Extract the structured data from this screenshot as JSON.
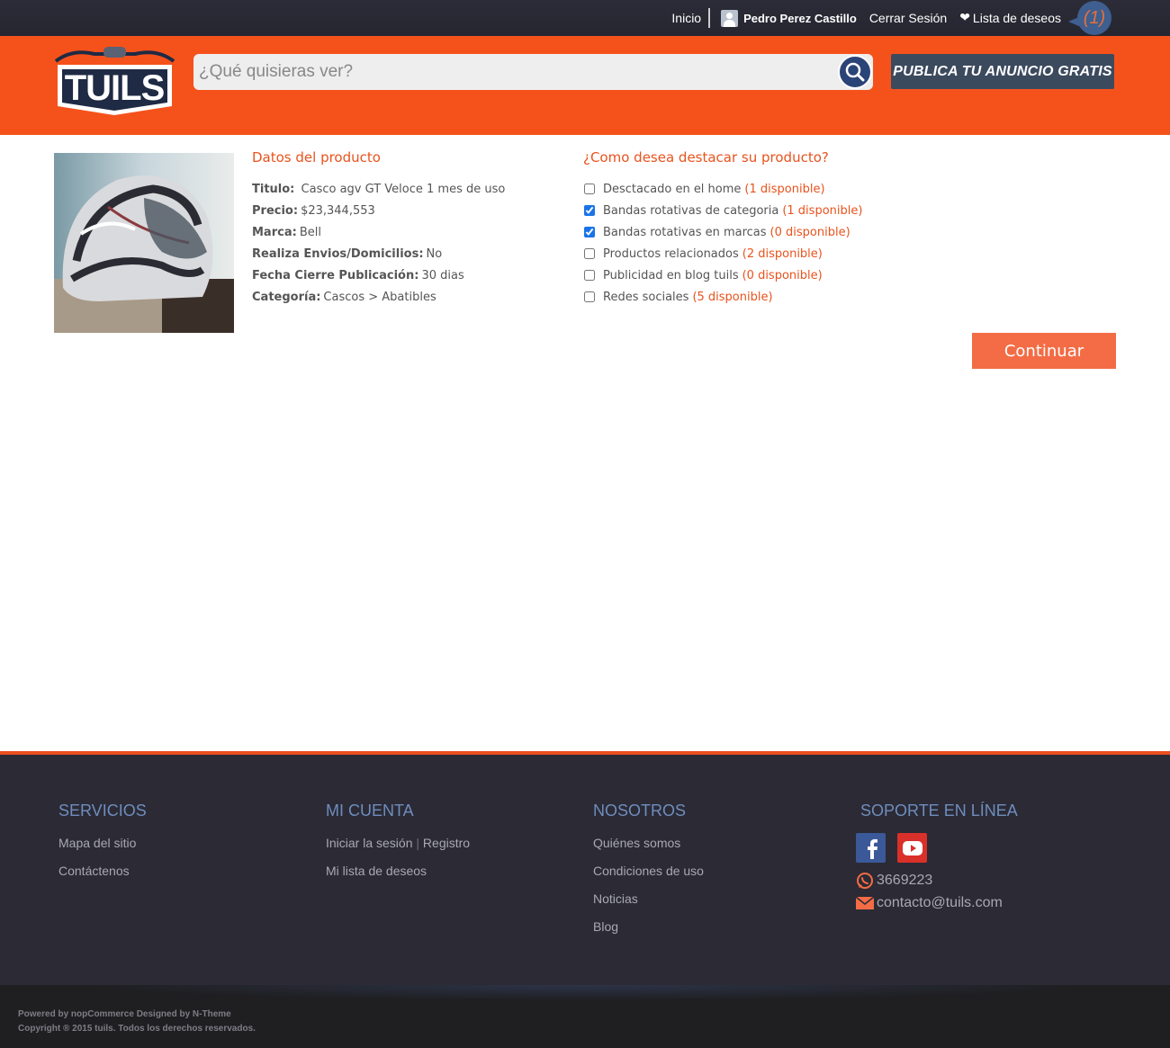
{
  "topbar": {
    "home": "Inicio",
    "user_name": "Pedro Perez Castillo",
    "logout": "Cerrar Sesión",
    "wishlist": "Lista de deseos",
    "wishlist_count": "(1)"
  },
  "header": {
    "logo_text": "TUILS",
    "search_placeholder": "¿Qué quisieras ver?",
    "publish_label": "PUBLICA TU ANUNCIO GRATIS"
  },
  "product": {
    "section_title": "Datos del producto",
    "details": [
      {
        "label": "Titulo:",
        "value": " Casco agv GT Veloce 1 mes de uso"
      },
      {
        "label": "Precio:",
        "value": "$23,344,553"
      },
      {
        "label": "Marca:",
        "value": "Bell"
      },
      {
        "label": "Realiza Envios/Domicilios:",
        "value": "No"
      },
      {
        "label": "Fecha Cierre Publicación:",
        "value": "30 dias"
      },
      {
        "label": "Categoría:",
        "value": "Cascos > Abatibles"
      }
    ]
  },
  "highlight": {
    "section_title": "¿Como desea destacar su producto?",
    "options": [
      {
        "label": "Desctacado en el home",
        "availability": "(1 disponible)",
        "checked": false
      },
      {
        "label": "Bandas rotativas de categoria",
        "availability": "(1 disponible)",
        "checked": true
      },
      {
        "label": "Bandas rotativas en marcas",
        "availability": "(0 disponible)",
        "checked": true
      },
      {
        "label": "Productos relacionados",
        "availability": "(2 disponible)",
        "checked": false
      },
      {
        "label": "Publicidad en blog tuils",
        "availability": "(0 disponible)",
        "checked": false
      },
      {
        "label": "Redes sociales",
        "availability": "(5 disponible)",
        "checked": false
      }
    ],
    "continue_label": "Continuar"
  },
  "footer": {
    "servicios": {
      "title": "SERVICIOS",
      "links": [
        "Mapa del sitio",
        "Contáctenos"
      ]
    },
    "cuenta": {
      "title": "MI CUENTA",
      "login": "Iniciar la sesión",
      "sep": "|",
      "register": "Registro",
      "wishlist": "Mi lista de deseos"
    },
    "nosotros": {
      "title": "NOSOTROS",
      "links": [
        "Quiénes somos",
        "Condiciones de uso",
        "Noticias",
        "Blog"
      ]
    },
    "soporte": {
      "title": "SOPORTE EN LÍNEA",
      "phone": "3669223",
      "email": "contacto@tuils.com"
    },
    "powered": "Powered by nopCommerce Designed by N-Theme",
    "copyright": "Copyright ® 2015 tuils. Todos los derechos reservados."
  },
  "colors": {
    "brand_orange": "#f5521b",
    "topbar_dark": "#2a2a35",
    "footer_heading": "#6f8dbd",
    "availability": "#e8531d"
  },
  "icons": [
    "user-avatar-icon",
    "heart-icon",
    "search-icon",
    "facebook-icon",
    "youtube-icon",
    "whatsapp-icon",
    "mail-icon"
  ]
}
